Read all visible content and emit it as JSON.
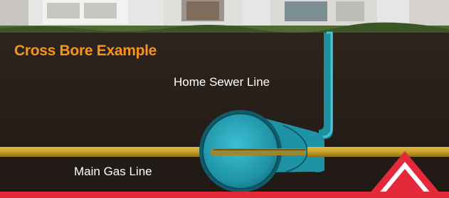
{
  "diagram": {
    "title": "Cross Bore Example",
    "labels": {
      "sewer_line": "Home Sewer Line",
      "gas_line": "Main Gas Line"
    }
  },
  "colors": {
    "title": "#f7941d",
    "label_text": "#ffffff",
    "soil": "#2a211b",
    "sewer_pipe": "#29a3b5",
    "gas_line": "#c9a22b",
    "accent": "#e4293b"
  },
  "icons": {
    "house": "house-icon",
    "grass": "grass-icon",
    "warning": "warning-triangle-icon"
  }
}
